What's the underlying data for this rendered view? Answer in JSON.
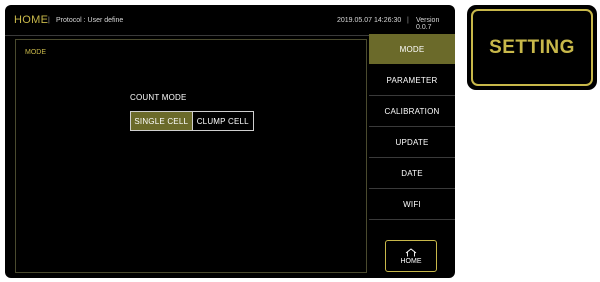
{
  "topbar": {
    "home_label": "HOME",
    "separator": "|",
    "protocol": "Protocol : User define",
    "datetime": "2019.05.07 14:26:30",
    "version": "Version 0.0.7"
  },
  "content": {
    "section_label": "MODE",
    "count_mode_label": "COUNT MODE",
    "options": [
      "SINGLE CELL",
      "CLUMP CELL"
    ],
    "selected_option": "SINGLE CELL"
  },
  "menu": {
    "items": [
      {
        "label": "MODE",
        "active": true
      },
      {
        "label": "PARAMETER",
        "active": false
      },
      {
        "label": "CALIBRATION",
        "active": false
      },
      {
        "label": "UPDATE",
        "active": false
      },
      {
        "label": "DATE",
        "active": false
      },
      {
        "label": "WIFI",
        "active": false
      }
    ],
    "home_button_label": "HOME",
    "home_button_icon": "home-icon"
  },
  "setting_card": {
    "label": "SETTING"
  },
  "colors": {
    "accent": "#c8b84a",
    "active_fill": "#6b6a2a",
    "screen_bg": "#000000"
  }
}
